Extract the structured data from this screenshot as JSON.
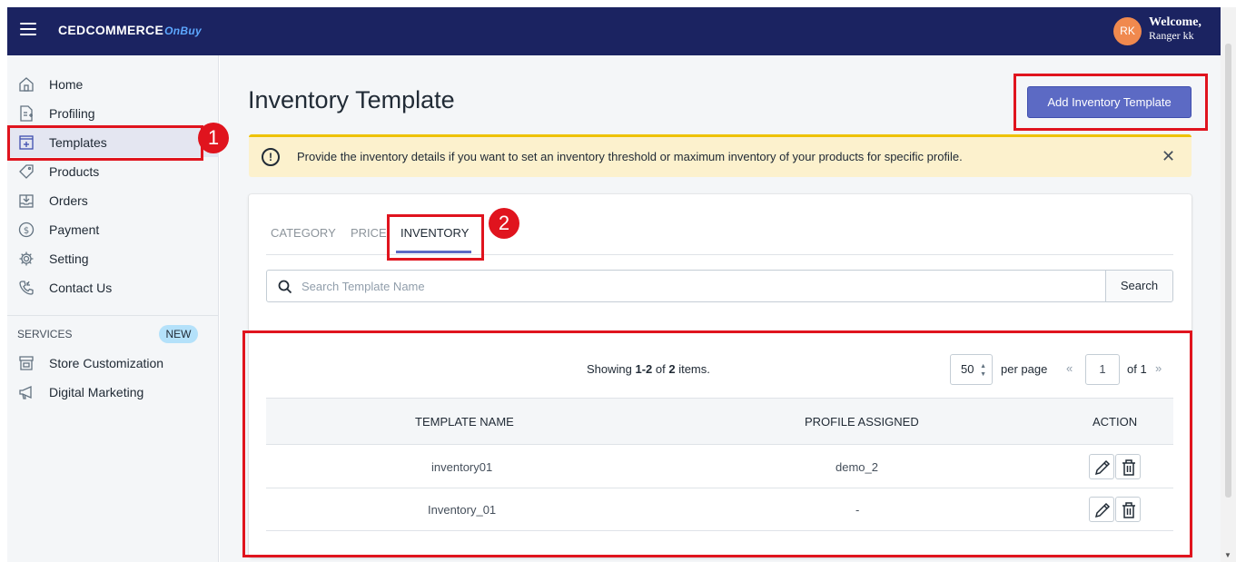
{
  "header": {
    "brand": "CEDCOMMERCE",
    "brand_sub": "OnBuy",
    "avatar_initials": "RK",
    "welcome": "Welcome,",
    "user_name": "Ranger kk"
  },
  "sidebar": {
    "items": [
      {
        "label": "Home",
        "icon": "home-icon"
      },
      {
        "label": "Profiling",
        "icon": "profiling-icon"
      },
      {
        "label": "Templates",
        "icon": "templates-icon",
        "active": true
      },
      {
        "label": "Products",
        "icon": "tag-icon"
      },
      {
        "label": "Orders",
        "icon": "orders-icon"
      },
      {
        "label": "Payment",
        "icon": "dollar-icon"
      },
      {
        "label": "Setting",
        "icon": "gear-icon"
      },
      {
        "label": "Contact Us",
        "icon": "phone-icon"
      }
    ],
    "services_label": "SERVICES",
    "new_badge": "NEW",
    "services": [
      {
        "label": "Store Customization",
        "icon": "store-icon"
      },
      {
        "label": "Digital Marketing",
        "icon": "megaphone-icon"
      }
    ]
  },
  "annotations": {
    "step1": "1",
    "step2": "2"
  },
  "main": {
    "title": "Inventory Template",
    "add_button": "Add Inventory Template",
    "banner": {
      "icon_symbol": "!",
      "text": "Provide the inventory details if you want to set an inventory threshold or maximum inventory of your products for specific profile.",
      "close": "✕"
    },
    "tabs": [
      {
        "label": "CATEGORY",
        "active": false
      },
      {
        "label": "PRICE",
        "active": false
      },
      {
        "label": "INVENTORY",
        "active": true
      }
    ],
    "search": {
      "placeholder": "Search Template Name",
      "value": "",
      "button": "Search"
    },
    "pagination": {
      "showing_prefix": "Showing ",
      "range": "1-2",
      "of_text": " of ",
      "total": "2",
      "suffix": " items.",
      "per_page_value": "50",
      "per_page_label": "per page",
      "prev": "«",
      "page": "1",
      "of_pages": "of 1",
      "next": "»"
    },
    "table": {
      "columns": [
        "TEMPLATE NAME",
        "PROFILE ASSIGNED",
        "ACTION"
      ],
      "rows": [
        {
          "name": "inventory01",
          "profile": "demo_2"
        },
        {
          "name": "Inventory_01",
          "profile": "-"
        }
      ]
    }
  },
  "colors": {
    "topbar": "#1b2361",
    "accent": "#5c6ac4",
    "annotation_red": "#e0141e",
    "banner_bg": "#fcf1cd"
  }
}
